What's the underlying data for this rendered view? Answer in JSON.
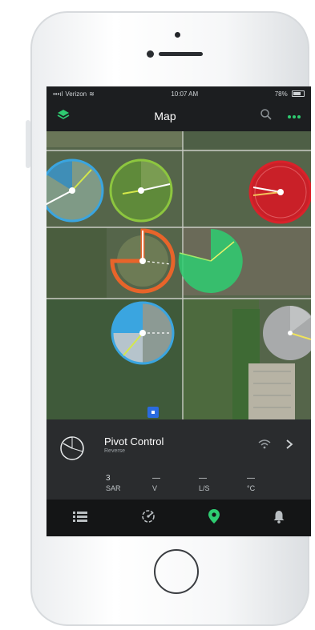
{
  "statusbar": {
    "carrier": "Verizon",
    "time": "10:07 AM",
    "battery": "78%"
  },
  "navbar": {
    "title": "Map",
    "left_icon": "layers-icon",
    "search_icon": "search-icon",
    "more_icon": "more-icon"
  },
  "colors": {
    "accent": "#2ecc71",
    "blue": "#3aa5e0",
    "green": "#8dc63f",
    "red": "#d9222a",
    "orange": "#e8642a",
    "gray": "#a8aaab"
  },
  "map": {
    "pivots": [
      {
        "name": "pivot-blue-top-left",
        "color": "blue"
      },
      {
        "name": "pivot-green-top",
        "color": "green"
      },
      {
        "name": "pivot-red-right",
        "color": "red"
      },
      {
        "name": "pivot-orange-middle",
        "color": "orange"
      },
      {
        "name": "pivot-teal-middle",
        "color": "accent"
      },
      {
        "name": "pivot-blue-bottom",
        "color": "blue"
      },
      {
        "name": "pivot-gray-right",
        "color": "gray"
      }
    ]
  },
  "info": {
    "title": "Pivot Control",
    "subtitle": "Reverse",
    "stats": [
      {
        "value": "3",
        "unit": "SAR"
      },
      {
        "value": "—",
        "unit": "V"
      },
      {
        "value": "—",
        "unit": "L/S"
      },
      {
        "value": "—",
        "unit": "°C"
      }
    ]
  },
  "tabs": [
    {
      "name": "list",
      "icon": "list-icon"
    },
    {
      "name": "pivot",
      "icon": "pivot-icon"
    },
    {
      "name": "map",
      "icon": "map-pin-icon"
    },
    {
      "name": "alerts",
      "icon": "bell-icon"
    }
  ]
}
